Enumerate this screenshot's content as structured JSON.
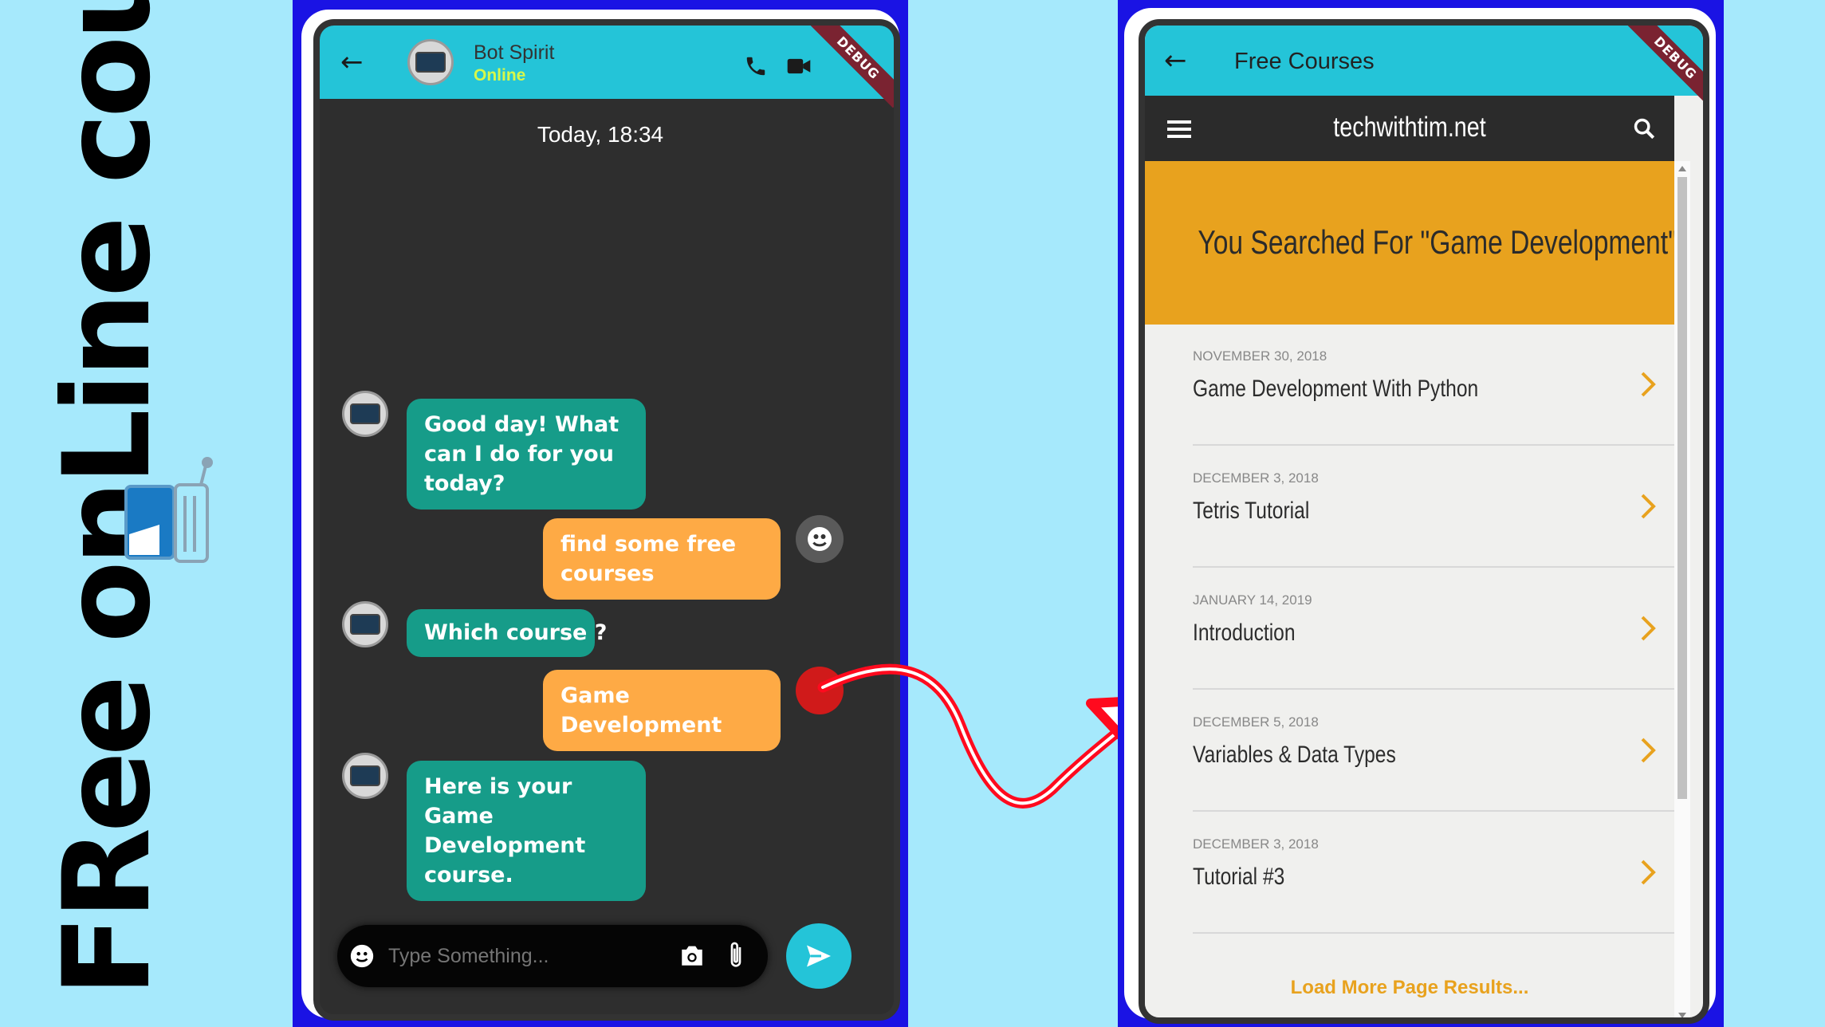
{
  "vertical_title": "FRee onLine couRses",
  "chat": {
    "contact_name": "Bot Spirit",
    "status": "Online",
    "debug_label": "DEBUG",
    "date_header": "Today, 18:34",
    "messages": [
      {
        "from": "bot",
        "text": "Good day! What can I do for you today?"
      },
      {
        "from": "user",
        "text": "find some free courses"
      },
      {
        "from": "bot",
        "text": "Which course ?"
      },
      {
        "from": "user",
        "text": "Game Development"
      },
      {
        "from": "bot",
        "text": "Here is your Game Development course."
      }
    ],
    "input_placeholder": "Type Something..."
  },
  "browser": {
    "appbar_title": "Free Courses",
    "debug_label": "DEBUG",
    "site_name": "techwithtim.net",
    "search_heading": "You Searched For \"Game Development\":",
    "results": [
      {
        "date": "NOVEMBER 30, 2018",
        "title": "Game Development With Python"
      },
      {
        "date": "DECEMBER 3, 2018",
        "title": "Tetris Tutorial"
      },
      {
        "date": "JANUARY 14, 2019",
        "title": "Introduction"
      },
      {
        "date": "DECEMBER 5, 2018",
        "title": "Variables & Data Types"
      },
      {
        "date": "DECEMBER 3, 2018",
        "title": "Tutorial #3"
      }
    ],
    "load_more": "Load More Page Results..."
  },
  "colors": {
    "background": "#a6e9fc",
    "frame": "#1a13e4",
    "appbar": "#24c4d8",
    "bot_bubble": "#169c89",
    "user_bubble": "#feaa45",
    "banner": "#e8a21e",
    "arrow": "#ff0a1e"
  }
}
